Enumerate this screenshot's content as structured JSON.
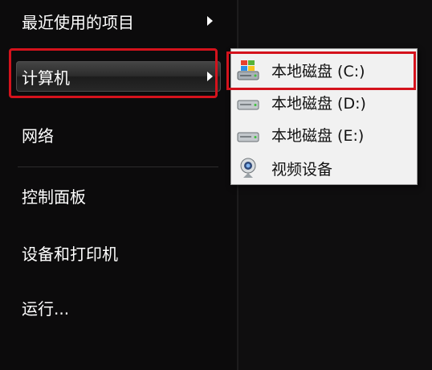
{
  "start_menu": {
    "items": [
      {
        "label": "最近使用的项目"
      },
      {
        "label": "计算机"
      },
      {
        "label": "网络"
      },
      {
        "label": "控制面板"
      },
      {
        "label": "设备和打印机"
      },
      {
        "label": "运行..."
      }
    ]
  },
  "computer_submenu": {
    "items": [
      {
        "label": "本地磁盘 (C:)",
        "icon": "windows-drive-icon"
      },
      {
        "label": "本地磁盘 (D:)",
        "icon": "hard-drive-icon"
      },
      {
        "label": "本地磁盘 (E:)",
        "icon": "hard-drive-icon"
      },
      {
        "label": "视频设备",
        "icon": "webcam-icon"
      }
    ]
  },
  "colors": {
    "menu_background": "#0c0b0c",
    "submenu_background": "#f1f1f1",
    "highlight_border": "#d4121c"
  }
}
